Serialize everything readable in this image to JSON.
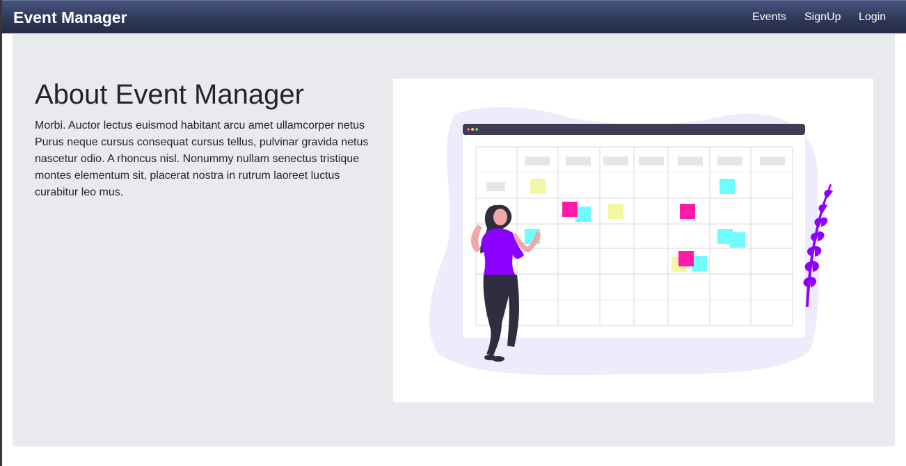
{
  "navbar": {
    "brand": "Event Manager",
    "links": [
      "Events",
      "SignUp",
      "Login"
    ]
  },
  "about": {
    "title": "About Event Manager",
    "body": "Morbi. Auctor lectus euismod habitant arcu amet ullamcorper netus Purus neque cursus consequat cursus tellus, pulvinar gravida netus nascetur odio. A rhoncus nisl. Nonummy nullam senectus tristique montes elementum sit, placerat nostra in rutrum laoreet luctus curabitur leo mus."
  },
  "colors": {
    "navbar": "#2d3656",
    "jumbotron": "#e9eaed",
    "accent_purple": "#8b00ff",
    "note_pink": "#ff1aa8",
    "note_cyan": "#6ffcff",
    "note_yellow": "#f3f7a3"
  }
}
